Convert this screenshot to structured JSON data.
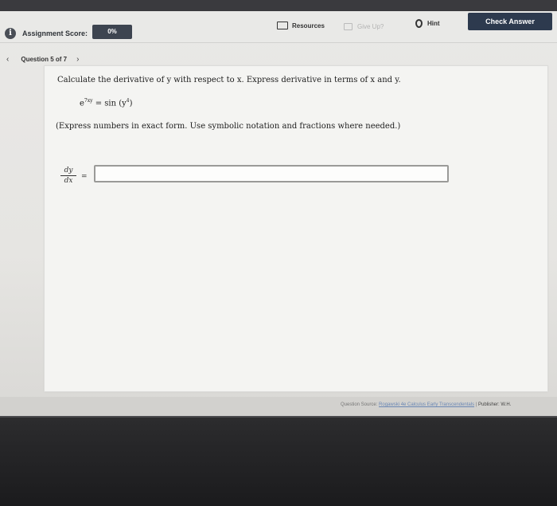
{
  "header": {
    "score_label": "Assignment Score:",
    "score_value": "0%",
    "resources_label": "Resources",
    "giveup_label": "Give Up?",
    "hint_label": "Hint",
    "check_answer_label": "Check Answer"
  },
  "nav": {
    "prev_icon": "chevron-left-icon",
    "question_label": "Question 5 of 7",
    "next_icon": "chevron-right-icon"
  },
  "question": {
    "prompt": "Calculate the derivative of y with respect to x. Express derivative in terms of x and y.",
    "equation_lhs_base": "e",
    "equation_lhs_exp": "7xy",
    "equation_rhs": "= sin (y",
    "equation_rhs_exp": "4",
    "equation_rhs_close": ")",
    "instructions": "(Express numbers in exact form. Use symbolic notation and fractions where needed.)",
    "fraction_num": "dy",
    "fraction_den": "dx",
    "equals": "=",
    "answer_value": ""
  },
  "footer": {
    "source_prefix": "Question Source:",
    "source_link": "Rogawski 4e Calculus Early Transcendentals",
    "separator": "|",
    "publisher": "Publisher: W.H."
  },
  "colors": {
    "check_answer_bg": "#2d3a4e",
    "score_badge_bg": "#3d4450",
    "link": "#6a87b4"
  }
}
